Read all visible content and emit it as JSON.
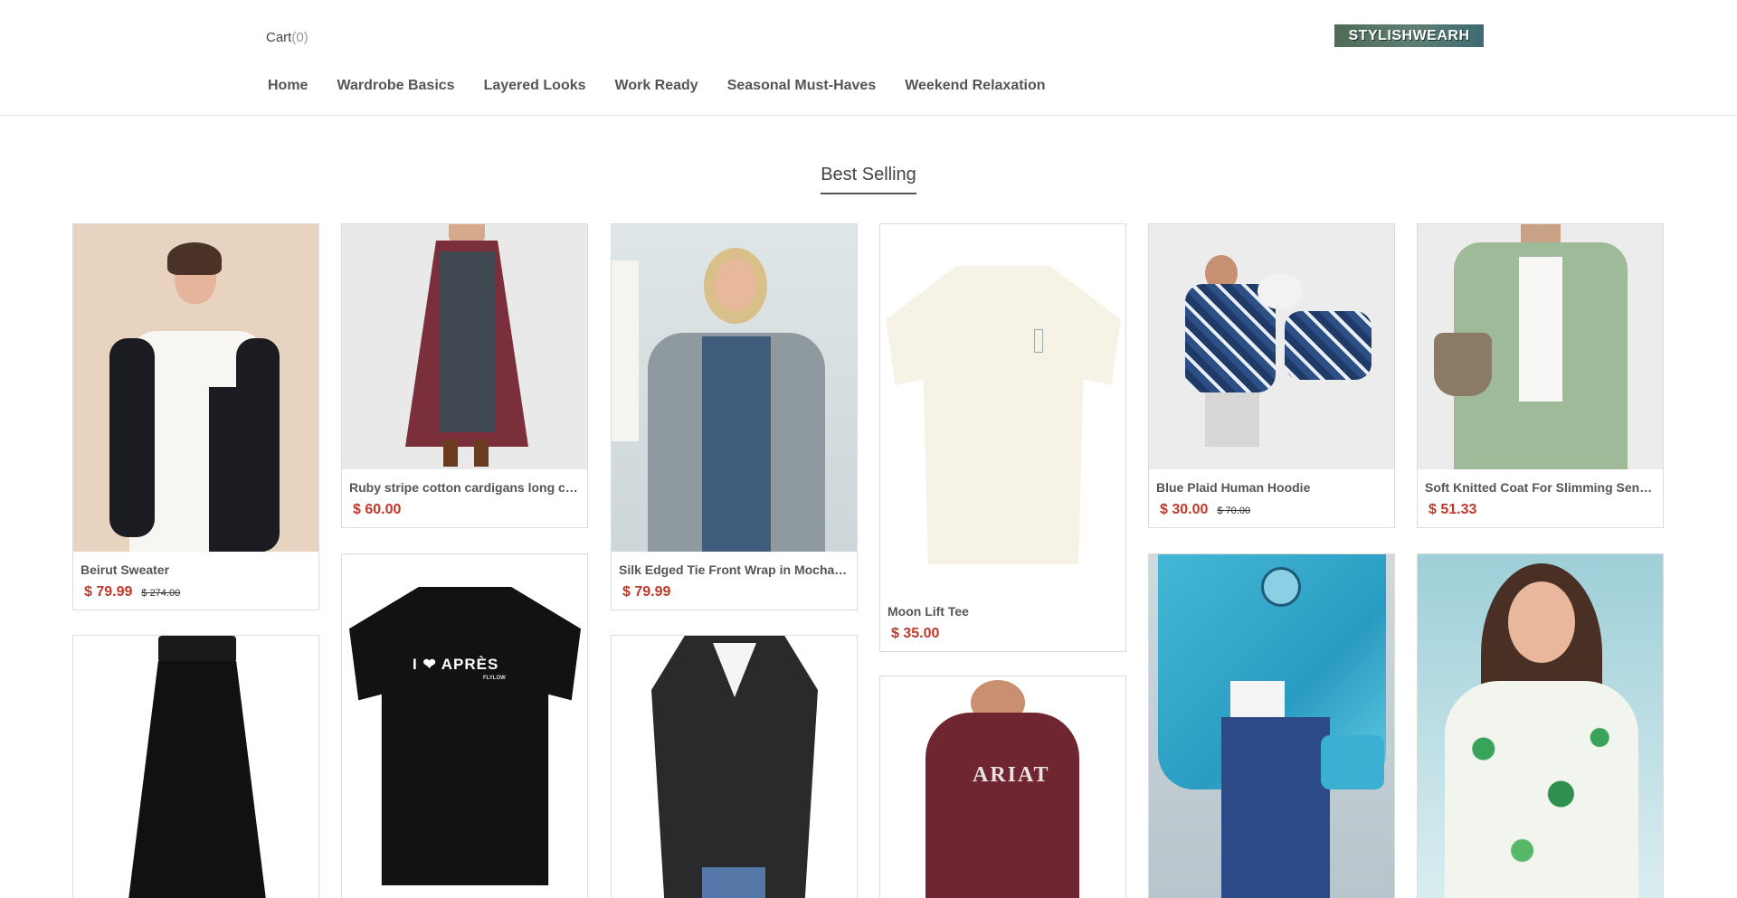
{
  "header": {
    "cart_label": "Cart",
    "cart_count": "(0)",
    "logo_text": "STYLISHWEARH"
  },
  "nav": {
    "items": [
      {
        "label": "Home"
      },
      {
        "label": "Wardrobe Basics"
      },
      {
        "label": "Layered Looks"
      },
      {
        "label": "Work Ready"
      },
      {
        "label": "Seasonal Must-Haves"
      },
      {
        "label": "Weekend Relaxation"
      }
    ]
  },
  "section": {
    "title": "Best Selling"
  },
  "products": [
    {
      "name": "Beirut Sweater",
      "price": "$ 79.99",
      "old_price": "$ 274.00"
    },
    {
      "name": "Ruby stripe cotton cardigans long c…",
      "price": "$ 60.00",
      "old_price": ""
    },
    {
      "name": "Silk Edged Tie Front Wrap in Mocha…",
      "price": "$ 79.99",
      "old_price": ""
    },
    {
      "name": "Moon Lift Tee",
      "price": "$ 35.00",
      "old_price": ""
    },
    {
      "name": "Blue Plaid Human Hoodie",
      "price": "$ 30.00",
      "old_price": "$ 70.00"
    },
    {
      "name": "Soft Knitted Coat For Slimming Sen…",
      "price": "$ 51.33",
      "old_price": ""
    }
  ],
  "image_text": {
    "tee_print": "I ❤ APRÈS",
    "tee_print_sub": "FLYLOW",
    "hoodie_print": "ARIAT"
  },
  "colors": {
    "price_red": "#c0392b",
    "logo_bg": "#4e6b55"
  }
}
